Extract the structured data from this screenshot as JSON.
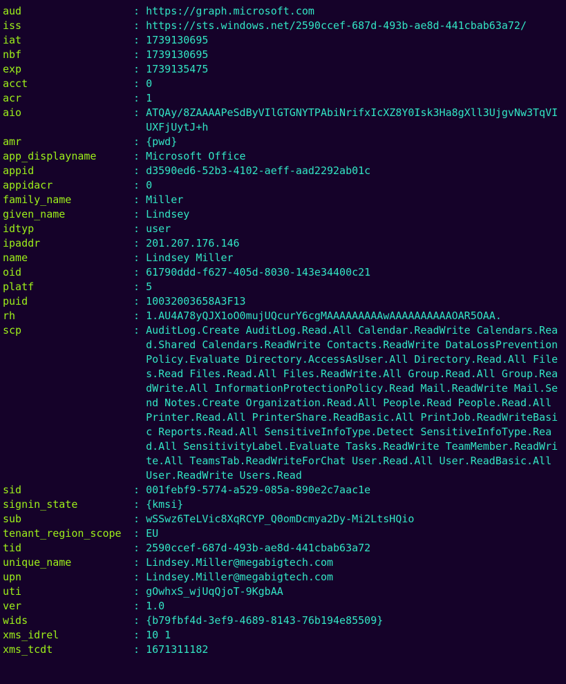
{
  "claims": [
    {
      "key": "aud",
      "value": "https://graph.microsoft.com"
    },
    {
      "key": "iss",
      "value": "https://sts.windows.net/2590ccef-687d-493b-ae8d-441cbab63a72/"
    },
    {
      "key": "iat",
      "value": "1739130695"
    },
    {
      "key": "nbf",
      "value": "1739130695"
    },
    {
      "key": "exp",
      "value": "1739135475"
    },
    {
      "key": "acct",
      "value": "0"
    },
    {
      "key": "acr",
      "value": "1"
    },
    {
      "key": "aio",
      "value": "ATQAy/8ZAAAAPeSdByVIlGTGNYTPAbiNrifxIcXZ8Y0Isk3Ha8gXll3UjgvNw3TqVIUXFjUytJ+h"
    },
    {
      "key": "amr",
      "value": "{pwd}"
    },
    {
      "key": "app_displayname",
      "value": "Microsoft Office"
    },
    {
      "key": "appid",
      "value": "d3590ed6-52b3-4102-aeff-aad2292ab01c"
    },
    {
      "key": "appidacr",
      "value": "0"
    },
    {
      "key": "family_name",
      "value": "Miller"
    },
    {
      "key": "given_name",
      "value": "Lindsey"
    },
    {
      "key": "idtyp",
      "value": "user"
    },
    {
      "key": "ipaddr",
      "value": "201.207.176.146"
    },
    {
      "key": "name",
      "value": "Lindsey Miller"
    },
    {
      "key": "oid",
      "value": "61790ddd-f627-405d-8030-143e34400c21"
    },
    {
      "key": "platf",
      "value": "5"
    },
    {
      "key": "puid",
      "value": "10032003658A3F13"
    },
    {
      "key": "rh",
      "value": "1.AU4A78yQJX1oO0mujUQcurY6cgMAAAAAAAAAwAAAAAAAAAAOAR5OAA."
    },
    {
      "key": "scp",
      "value": "AuditLog.Create AuditLog.Read.All Calendar.ReadWrite Calendars.Read.Shared Calendars.ReadWrite Contacts.ReadWrite DataLossPreventionPolicy.Evaluate Directory.AccessAsUser.All Directory.Read.All Files.Read Files.Read.All Files.ReadWrite.All Group.Read.All Group.ReadWrite.All InformationProtectionPolicy.Read Mail.ReadWrite Mail.Send Notes.Create Organization.Read.All People.Read People.Read.All Printer.Read.All PrinterShare.ReadBasic.All PrintJob.ReadWriteBasic Reports.Read.All SensitiveInfoType.Detect SensitiveInfoType.Read.All SensitivityLabel.Evaluate Tasks.ReadWrite TeamMember.ReadWrite.All TeamsTab.ReadWriteForChat User.Read.All User.ReadBasic.All User.ReadWrite Users.Read"
    },
    {
      "key": "sid",
      "value": "001febf9-5774-a529-085a-890e2c7aac1e"
    },
    {
      "key": "signin_state",
      "value": "{kmsi}"
    },
    {
      "key": "sub",
      "value": "wSSwz6TeLVic8XqRCYP_Q0omDcmya2Dy-Mi2LtsHQio"
    },
    {
      "key": "tenant_region_scope",
      "value": "EU"
    },
    {
      "key": "tid",
      "value": "2590ccef-687d-493b-ae8d-441cbab63a72"
    },
    {
      "key": "unique_name",
      "value": "Lindsey.Miller@megabigtech.com"
    },
    {
      "key": "upn",
      "value": "Lindsey.Miller@megabigtech.com"
    },
    {
      "key": "uti",
      "value": "gOwhxS_wjUqQjoT-9KgbAA"
    },
    {
      "key": "ver",
      "value": "1.0"
    },
    {
      "key": "wids",
      "value": "{b79fbf4d-3ef9-4689-8143-76b194e85509}"
    },
    {
      "key": "xms_idrel",
      "value": "10 1"
    },
    {
      "key": "xms_tcdt",
      "value": "1671311182"
    }
  ],
  "layout": {
    "key_width_chars": 19
  }
}
